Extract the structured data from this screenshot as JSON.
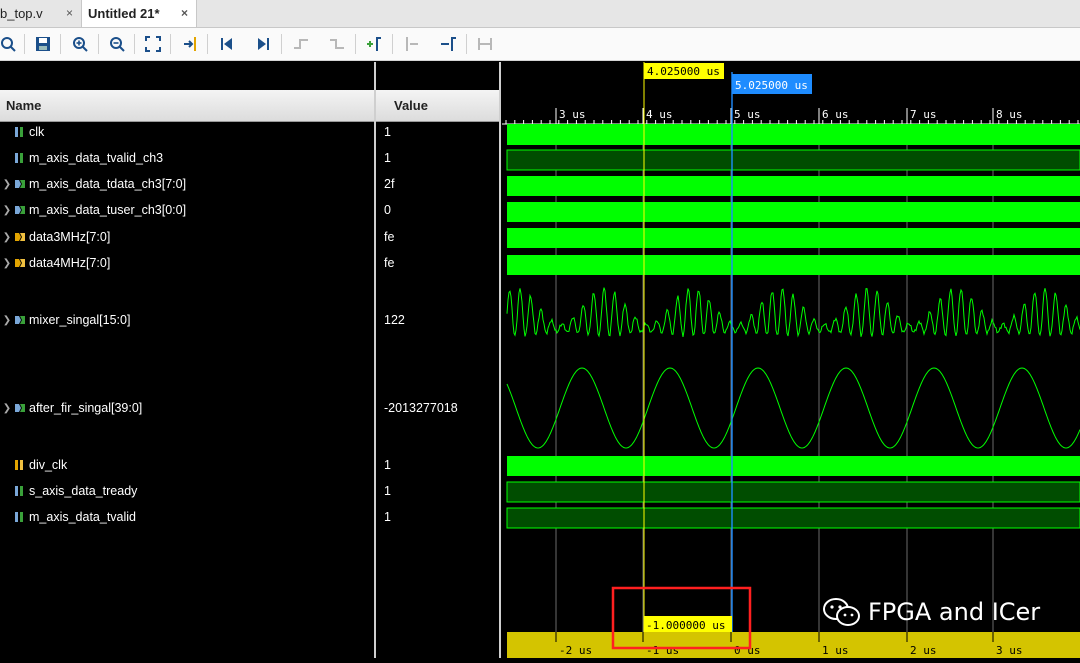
{
  "tabs": [
    {
      "label": "b_top.v",
      "close": "×"
    },
    {
      "label": "Untitled 21*",
      "close": "×"
    }
  ],
  "toolbar": {
    "buttons": [
      "search-icon",
      "save-icon",
      "zoom-in-icon",
      "zoom-out-icon",
      "zoom-fit-icon",
      "go-to-cursor-icon",
      "go-to-first-icon",
      "go-to-last-icon",
      "add-marker-icon",
      "previous-transition-icon",
      "next-transition-icon",
      "add-marker-2-icon",
      "swap-cursor-icon",
      "snap-icon"
    ]
  },
  "columns": {
    "name": "Name",
    "value": "Value"
  },
  "signals": [
    {
      "name": "clk",
      "value": "1",
      "icon": "bit-icon",
      "expandable": false
    },
    {
      "name": "m_axis_data_tvalid_ch3",
      "value": "1",
      "icon": "bit-icon",
      "expandable": false
    },
    {
      "name": "m_axis_data_tdata_ch3[7:0]",
      "value": "2f",
      "icon": "bus-icon",
      "expandable": true
    },
    {
      "name": "m_axis_data_tuser_ch3[0:0]",
      "value": "0",
      "icon": "bus-icon",
      "expandable": true
    },
    {
      "name": "data3MHz[7:0]",
      "value": "fe",
      "icon": "bus-orange-icon",
      "expandable": true
    },
    {
      "name": "data4MHz[7:0]",
      "value": "fe",
      "icon": "bus-orange-icon",
      "expandable": true
    },
    {
      "name": "mixer_singal[15:0]",
      "value": "122",
      "icon": "bus-icon",
      "expandable": true
    },
    {
      "name": "after_fir_singal[39:0]",
      "value": "-2013277018",
      "icon": "bus-icon",
      "expandable": true
    },
    {
      "name": "div_clk",
      "value": "1",
      "icon": "bit-orange-icon",
      "expandable": false
    },
    {
      "name": "s_axis_data_tready",
      "value": "1",
      "icon": "bit-icon",
      "expandable": false
    },
    {
      "name": "m_axis_data_tvalid",
      "value": "1",
      "icon": "bit-icon",
      "expandable": false
    }
  ],
  "cursors": {
    "primary": "4.025000 us",
    "secondary": "5.025000 us",
    "delta": "-1.000000 us"
  },
  "timeline": {
    "top_ticks": [
      "3 us",
      "4 us",
      "5 us",
      "6 us",
      "7 us",
      "8 us"
    ],
    "bottom_ticks": [
      "-2 us",
      "-1 us",
      "0 us",
      "1 us",
      "2 us",
      "3 us"
    ]
  },
  "colors": {
    "wave_green": "#00ff00",
    "wave_dark": "#004d00",
    "cursor_yellow": "#ffff00",
    "cursor_blue": "#1e8cff",
    "highlight_red": "#ff2020"
  },
  "watermark": "FPGA and ICer"
}
